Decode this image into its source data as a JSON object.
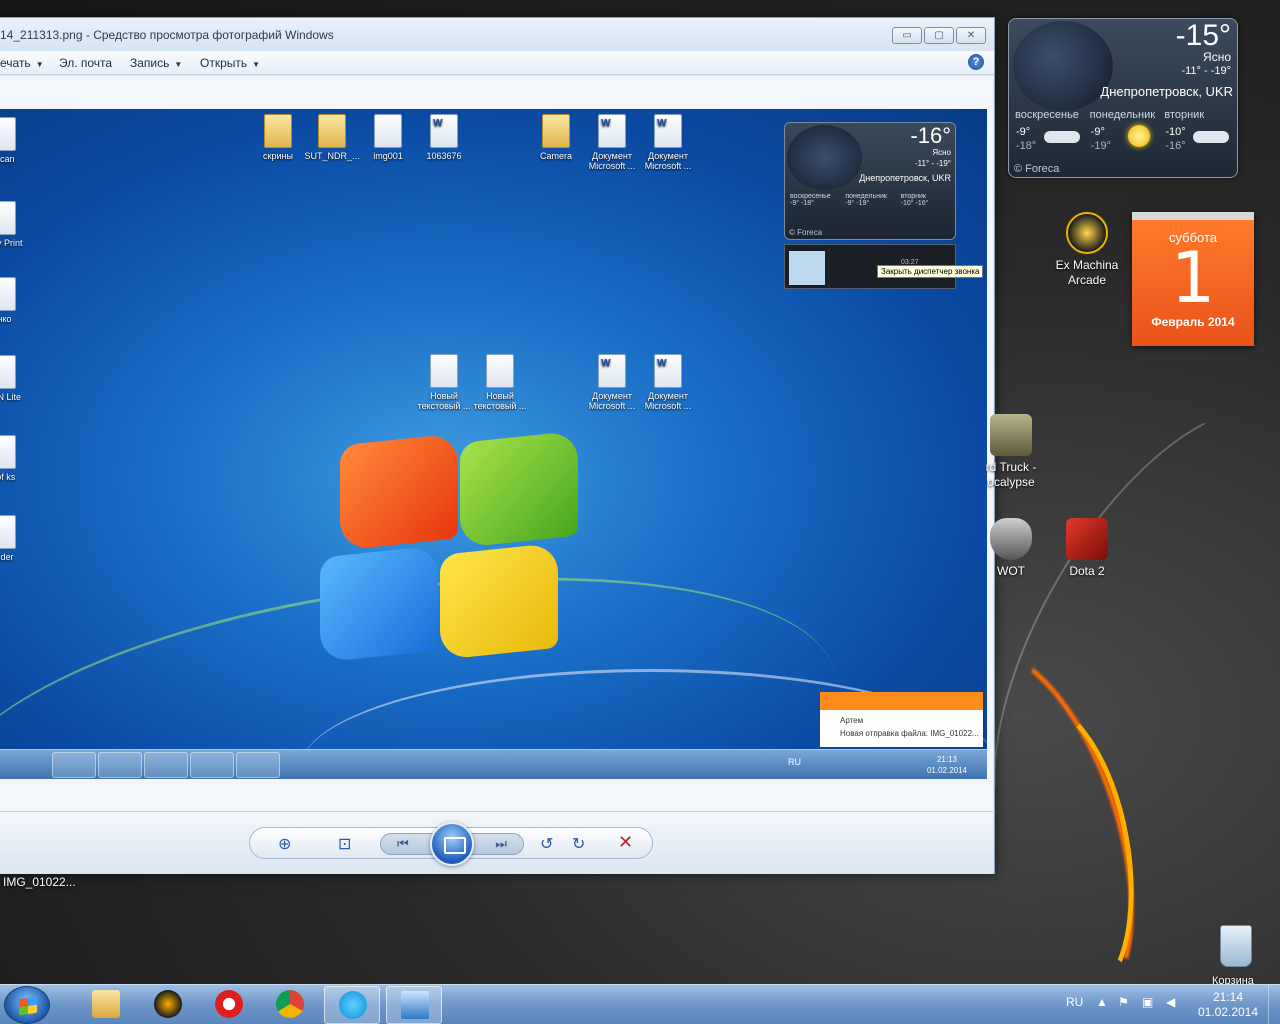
{
  "viewer": {
    "title": "14_211313.png - Средство просмотра фотографий Windows",
    "menu": {
      "print": "ечать",
      "email": "Эл. почта",
      "burn": "Запись",
      "open": "Открыть",
      "help": "?"
    },
    "window_buttons": {
      "minimize": "▭",
      "maximize": "▢",
      "close": "✕"
    },
    "screenshot": {
      "desktop_icons_left": [
        "l Scan",
        "Easy Print",
        "енко",
        "MON Lite",
        "d of ks",
        "under"
      ],
      "desktop_icons_top": [
        "скрины",
        "SUT_NDR_...",
        "img001",
        "1063676",
        "Camera",
        "Документ Microsoft ...",
        "Документ Microsoft ..."
      ],
      "desktop_icons_mid": [
        "Новый текстовый ...",
        "Новый текстовый ...",
        "Документ Microsoft ...",
        "Документ Microsoft ..."
      ],
      "weather": {
        "temp": "-16°",
        "cond": "Ясно",
        "range": "-11° - -19°",
        "city": "Днепропетровск, UKR",
        "days": [
          "воскресенье",
          "понедельник",
          "вторник"
        ],
        "vals": [
          "-9° -18°",
          "-9° -19°",
          "-10° -16°"
        ],
        "foreca": "© Foreca"
      },
      "call_time": "03:27",
      "tooltip": "Закрыть диспетчер звонка",
      "toast": {
        "name": "Артем",
        "text": "Новая отправка файла: IMG_01022..."
      },
      "taskbar": {
        "lang": "RU",
        "time": "21:13",
        "date": "01.02.2014"
      }
    }
  },
  "desktop": {
    "file_label": "IMG_01022...",
    "weather": {
      "temp": "-15°",
      "cond": "Ясно",
      "range": "-11° - -19°",
      "city": "Днепропетровск, UKR",
      "days": [
        {
          "name": "воскресенье",
          "hi": "-9°",
          "lo": "-18°",
          "icon": "cloud"
        },
        {
          "name": "понедельник",
          "hi": "-9°",
          "lo": "-19°",
          "icon": "sun"
        },
        {
          "name": "вторник",
          "hi": "-10°",
          "lo": "-16°",
          "icon": "cloud"
        }
      ],
      "foreca": "© Foreca"
    },
    "calendar": {
      "dow": "суббота",
      "day": "1",
      "month_year": "Февраль 2014"
    },
    "icons": {
      "exmachina": "Ex Machina Arcade",
      "truck": "rd Truck - ocalypse",
      "wot": "WOT",
      "dota": "Dota 2",
      "recycle": "Корзина"
    }
  },
  "taskbar": {
    "lang": "RU",
    "time": "21:14",
    "date": "01.02.2014"
  }
}
